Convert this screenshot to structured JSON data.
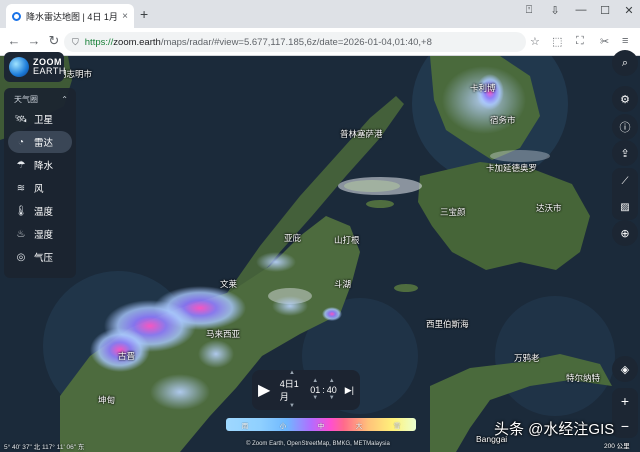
{
  "browser": {
    "tab_title": "降水雷达地图 | 4日 1月, 01",
    "tab_close": "×",
    "new_tab": "+",
    "url_scheme": "https://",
    "url_host": "zoom.earth",
    "url_rest": "/maps/radar/#view=5.677,117.185,6z/date=2026-01-04,01:40,+8"
  },
  "logo": {
    "line1": "ZOOM",
    "line2": "EARTH"
  },
  "panel": {
    "header": "天气圈",
    "layers": [
      {
        "label": "卫星",
        "icon": "satellite-icon"
      },
      {
        "label": "雷达",
        "icon": "radar-icon"
      },
      {
        "label": "降水",
        "icon": "precipitation-icon"
      },
      {
        "label": "风",
        "icon": "wind-icon"
      },
      {
        "label": "温度",
        "icon": "temperature-icon"
      },
      {
        "label": "湿度",
        "icon": "humidity-icon"
      },
      {
        "label": "气压",
        "icon": "pressure-icon"
      }
    ]
  },
  "places": [
    {
      "name": "卡利博",
      "label": "place-kalibo"
    },
    {
      "name": "普林塞萨港",
      "label": "place-puerto-princesa"
    },
    {
      "name": "卡加延德奥罗",
      "label": "place-cagayan-de-oro"
    },
    {
      "name": "三宝颜",
      "label": "place-zamboanga"
    },
    {
      "name": "达沃市",
      "label": "place-davao"
    },
    {
      "name": "斗湖",
      "label": "place-tawau"
    },
    {
      "name": "西里伯斯海",
      "label": "place-celebes-sea"
    },
    {
      "name": "马来西亚",
      "label": "place-malaysia"
    },
    {
      "name": "古晋",
      "label": "place-kuching"
    },
    {
      "name": "坤甸",
      "label": "place-pontianak"
    },
    {
      "name": "亚庇",
      "label": "place-kota-kinabalu"
    },
    {
      "name": "山打根",
      "label": "place-sandakan"
    },
    {
      "name": "文莱",
      "label": "place-brunei"
    },
    {
      "name": "万鸦老",
      "label": "place-manado"
    },
    {
      "name": "特尔纳特",
      "label": "place-ternate"
    },
    {
      "name": "Banggai",
      "label": "place-banggai"
    },
    {
      "name": "宿务市",
      "label": "place-cebu"
    },
    {
      "name": "胡志明市",
      "label": "place-ho-chi-minh"
    }
  ],
  "time_control": {
    "date": "4日1月",
    "hour": "01",
    "minute": "40",
    "separator": ":"
  },
  "legend": {
    "labels": [
      "雨",
      "小",
      "中",
      "大",
      "雪"
    ]
  },
  "status": {
    "coords": "5° 40' 37\" 北    117° 11' 06\" 东",
    "attribution": "© Zoom Earth, OpenStreetMap, BMKG, METMalaysia",
    "scale": "200 公里"
  },
  "watermark": "头条 @水经注GIS",
  "colors": {
    "sea": "#1b2a3a",
    "land": "#46603a",
    "radar_light": "#a9c8ff",
    "radar_heavy": "#ff55c8"
  }
}
